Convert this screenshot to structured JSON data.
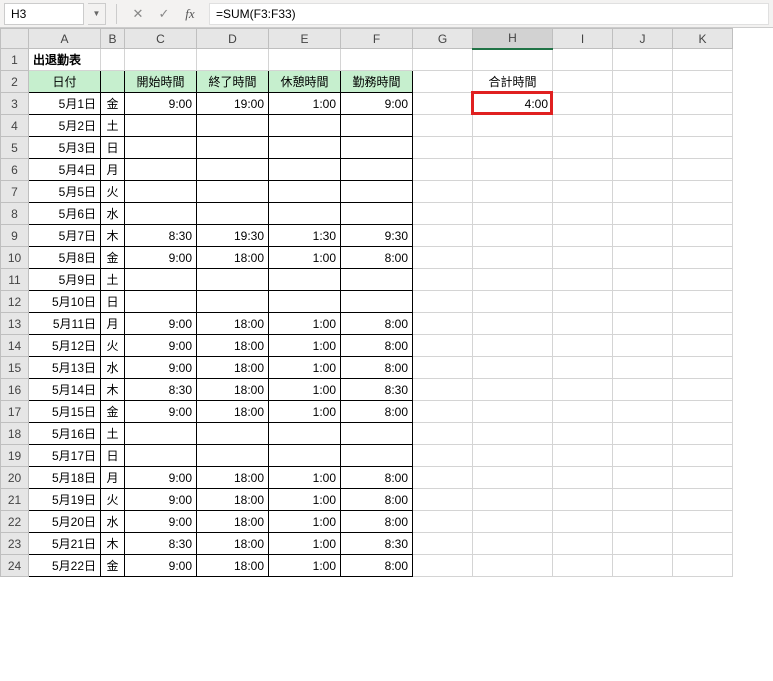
{
  "name_box": "H3",
  "formula": "=SUM(F3:F33)",
  "columns": [
    "A",
    "B",
    "C",
    "D",
    "E",
    "F",
    "G",
    "H",
    "I",
    "J",
    "K"
  ],
  "row_count": 24,
  "selected_cell": {
    "row": 3,
    "col": "H"
  },
  "title": "出退勤表",
  "headers": {
    "A": "日付",
    "C": "開始時間",
    "D": "終了時間",
    "E": "休憩時間",
    "F": "勤務時間",
    "H_label": "合計時間",
    "H_value": "4:00"
  },
  "rows": [
    {
      "date": "5月1日",
      "dow": "金",
      "start": "9:00",
      "end": "19:00",
      "break": "1:00",
      "work": "9:00"
    },
    {
      "date": "5月2日",
      "dow": "土",
      "start": "",
      "end": "",
      "break": "",
      "work": ""
    },
    {
      "date": "5月3日",
      "dow": "日",
      "start": "",
      "end": "",
      "break": "",
      "work": ""
    },
    {
      "date": "5月4日",
      "dow": "月",
      "start": "",
      "end": "",
      "break": "",
      "work": ""
    },
    {
      "date": "5月5日",
      "dow": "火",
      "start": "",
      "end": "",
      "break": "",
      "work": ""
    },
    {
      "date": "5月6日",
      "dow": "水",
      "start": "",
      "end": "",
      "break": "",
      "work": ""
    },
    {
      "date": "5月7日",
      "dow": "木",
      "start": "8:30",
      "end": "19:30",
      "break": "1:30",
      "work": "9:30"
    },
    {
      "date": "5月8日",
      "dow": "金",
      "start": "9:00",
      "end": "18:00",
      "break": "1:00",
      "work": "8:00"
    },
    {
      "date": "5月9日",
      "dow": "土",
      "start": "",
      "end": "",
      "break": "",
      "work": ""
    },
    {
      "date": "5月10日",
      "dow": "日",
      "start": "",
      "end": "",
      "break": "",
      "work": ""
    },
    {
      "date": "5月11日",
      "dow": "月",
      "start": "9:00",
      "end": "18:00",
      "break": "1:00",
      "work": "8:00"
    },
    {
      "date": "5月12日",
      "dow": "火",
      "start": "9:00",
      "end": "18:00",
      "break": "1:00",
      "work": "8:00"
    },
    {
      "date": "5月13日",
      "dow": "水",
      "start": "9:00",
      "end": "18:00",
      "break": "1:00",
      "work": "8:00"
    },
    {
      "date": "5月14日",
      "dow": "木",
      "start": "8:30",
      "end": "18:00",
      "break": "1:00",
      "work": "8:30"
    },
    {
      "date": "5月15日",
      "dow": "金",
      "start": "9:00",
      "end": "18:00",
      "break": "1:00",
      "work": "8:00"
    },
    {
      "date": "5月16日",
      "dow": "土",
      "start": "",
      "end": "",
      "break": "",
      "work": ""
    },
    {
      "date": "5月17日",
      "dow": "日",
      "start": "",
      "end": "",
      "break": "",
      "work": ""
    },
    {
      "date": "5月18日",
      "dow": "月",
      "start": "9:00",
      "end": "18:00",
      "break": "1:00",
      "work": "8:00"
    },
    {
      "date": "5月19日",
      "dow": "火",
      "start": "9:00",
      "end": "18:00",
      "break": "1:00",
      "work": "8:00"
    },
    {
      "date": "5月20日",
      "dow": "水",
      "start": "9:00",
      "end": "18:00",
      "break": "1:00",
      "work": "8:00"
    },
    {
      "date": "5月21日",
      "dow": "木",
      "start": "8:30",
      "end": "18:00",
      "break": "1:00",
      "work": "8:30"
    },
    {
      "date": "5月22日",
      "dow": "金",
      "start": "9:00",
      "end": "18:00",
      "break": "1:00",
      "work": "8:00"
    }
  ]
}
